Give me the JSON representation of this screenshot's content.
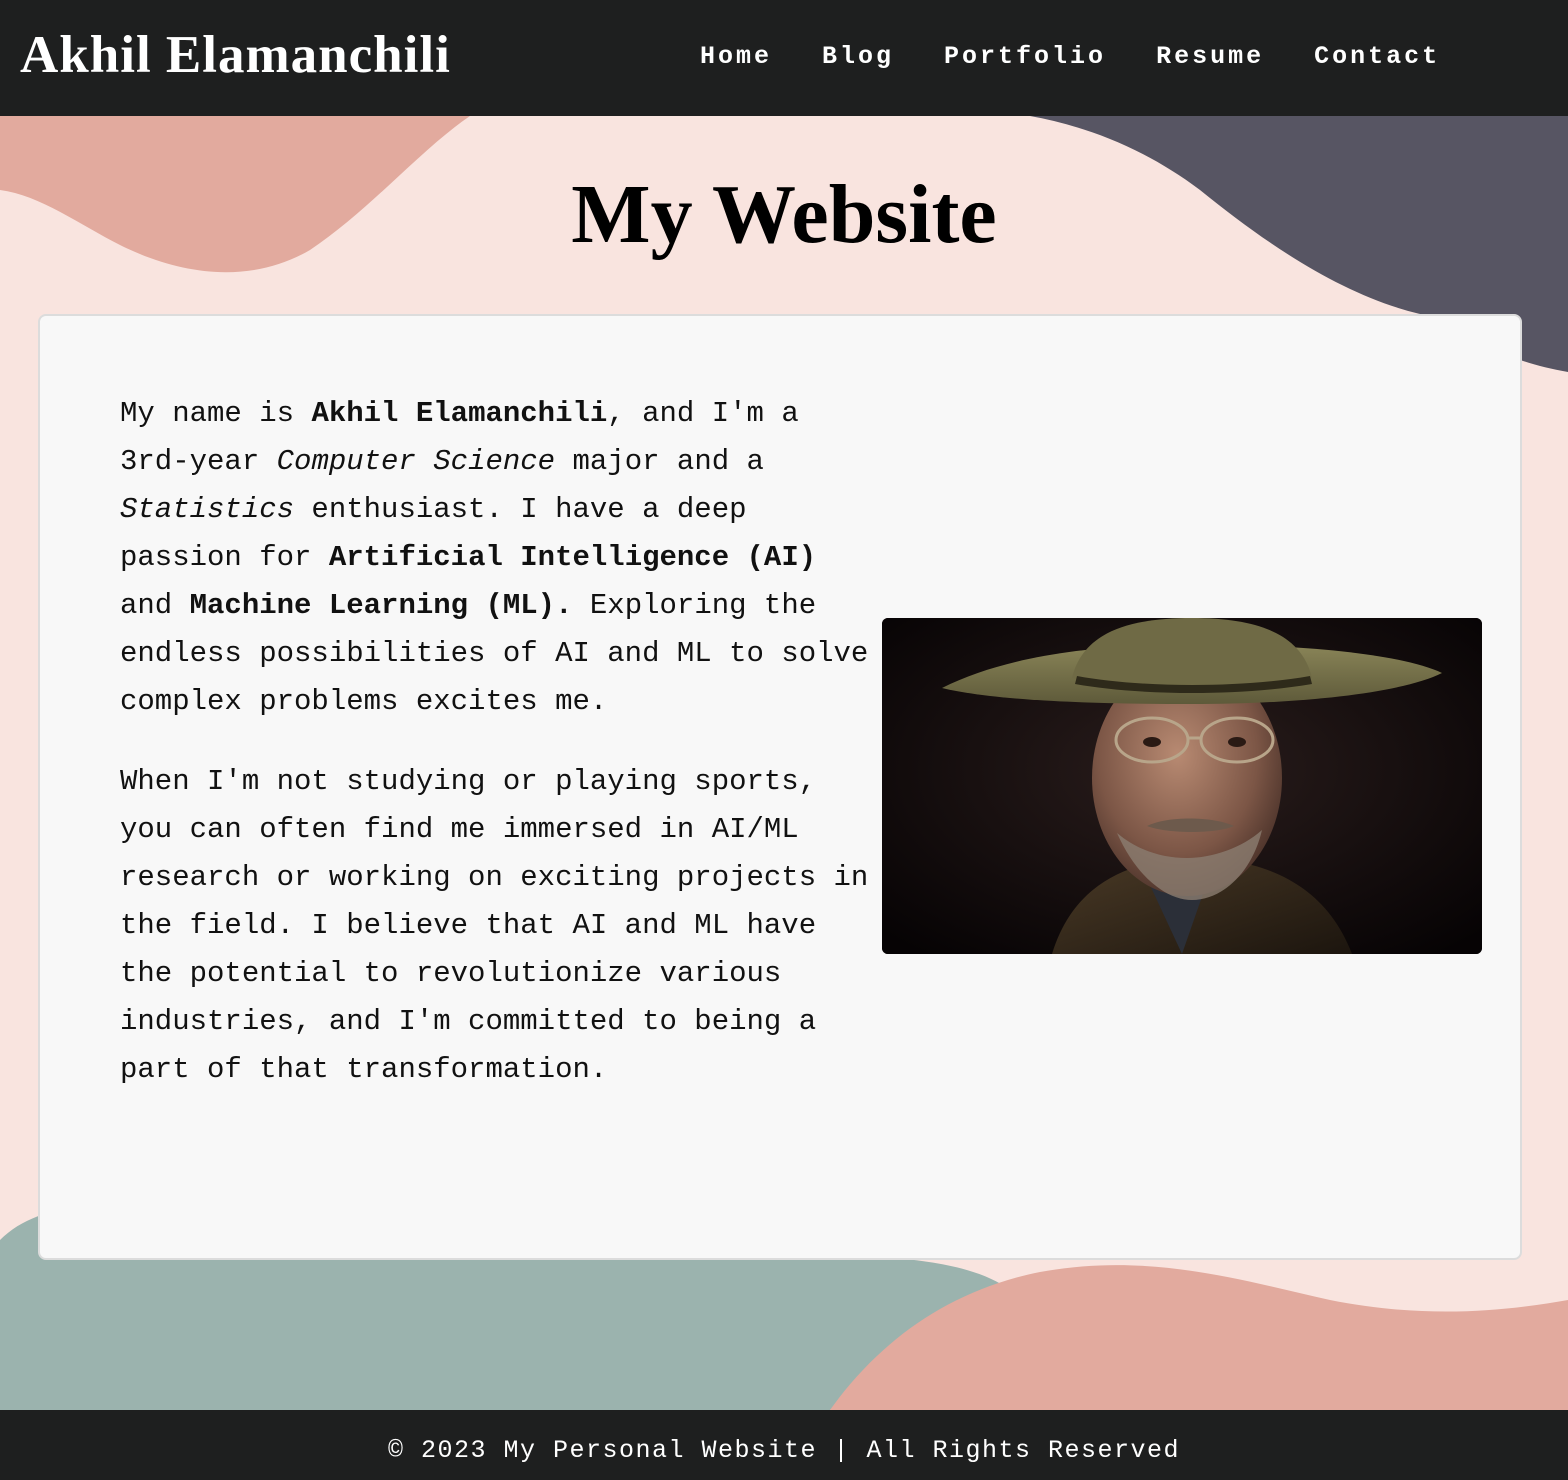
{
  "header": {
    "brand": "Akhil Elamanchili",
    "nav": [
      "Home",
      "Blog",
      "Portfolio",
      "Resume",
      "Contact"
    ]
  },
  "main": {
    "title": "My Website",
    "about": {
      "p1_a": "My name is ",
      "p1_name": "Akhil Elamanchili",
      "p1_b": ", and I'm a 3rd-year ",
      "p1_major": "Computer Science",
      "p1_c": " major and a ",
      "p1_stats": "Statistics",
      "p1_d": " enthusiast. I have a deep passion for ",
      "p1_ai": "Artificial Intelligence (AI)",
      "p1_e": " and ",
      "p1_ml": "Machine Learning (ML).",
      "p1_f": " Exploring the endless possibilities of AI and ML to solve complex problems excites me.",
      "p2": "When I'm not studying or playing sports, you can often find me immersed in AI/ML research or working on exciting projects in the field. I believe that AI and ML have the potential to revolutionize various industries, and I'm committed to being a part of that transformation."
    },
    "portrait_alt": "Portrait of a man in a hat and glasses"
  },
  "footer": {
    "text": "© 2023 My Personal Website | All Rights Reserved"
  },
  "colors": {
    "bar": "#1e1f1f",
    "background": "#f9e4df",
    "blob_pink": "#e2aa9e",
    "blob_slate": "#575563",
    "blob_teal": "#9bb3ae",
    "card": "#f8f8f8"
  }
}
